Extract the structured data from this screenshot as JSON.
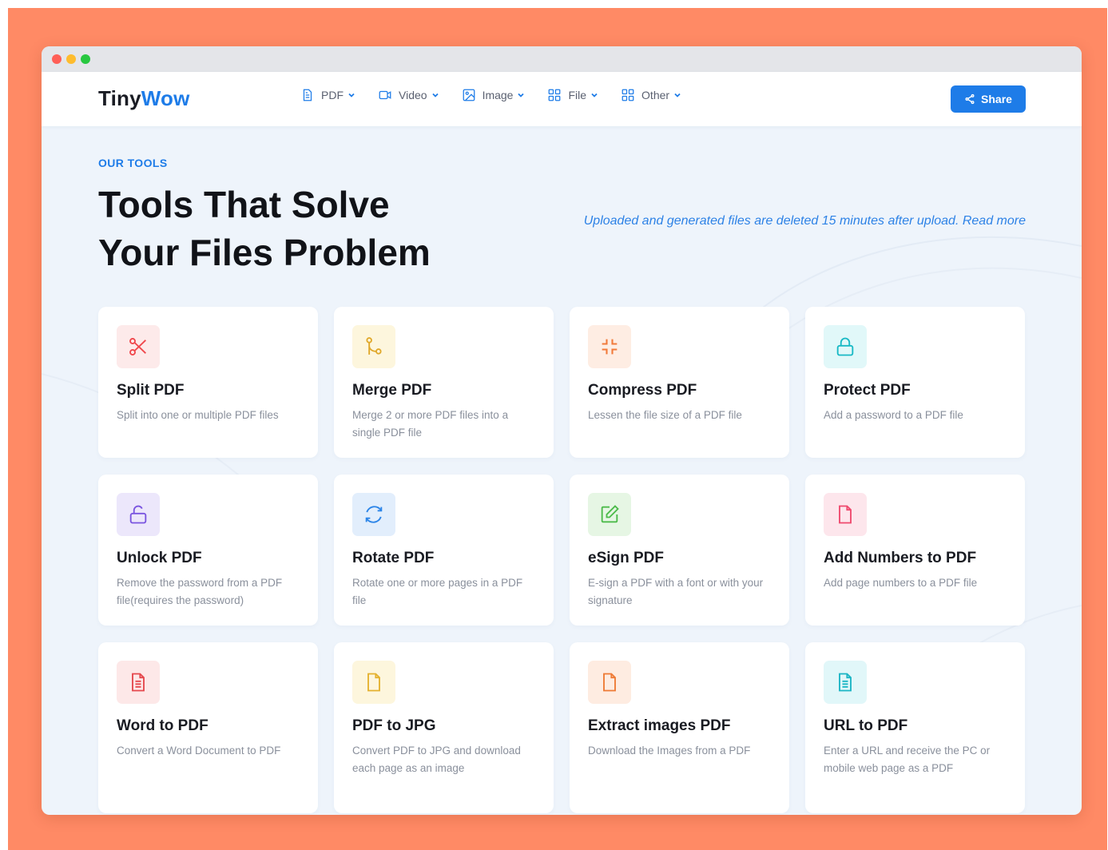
{
  "brand": {
    "name_part1": "Tiny",
    "name_part2": "Wow"
  },
  "nav": {
    "items": [
      {
        "label": "PDF",
        "icon": "document-icon"
      },
      {
        "label": "Video",
        "icon": "video-camera-icon"
      },
      {
        "label": "Image",
        "icon": "image-icon"
      },
      {
        "label": "File",
        "icon": "grid-icon"
      },
      {
        "label": "Other",
        "icon": "grid-icon"
      }
    ],
    "share_label": "Share"
  },
  "hero": {
    "eyebrow": "OUR TOOLS",
    "title_line1": "Tools That Solve",
    "title_line2": "Your Files Problem",
    "notice": "Uploaded and generated files are deleted 15 minutes after upload. Read more"
  },
  "tools": [
    {
      "title": "Split PDF",
      "desc": "Split into one or multiple PDF files",
      "icon": "scissors-icon",
      "color": "#f0464b",
      "bg": "#fdeaea"
    },
    {
      "title": "Merge PDF",
      "desc": "Merge 2 or more PDF files into a single PDF file",
      "icon": "merge-icon",
      "color": "#e0a82a",
      "bg": "#fdf6dd"
    },
    {
      "title": "Compress PDF",
      "desc": "Lessen the file size of a PDF file",
      "icon": "compress-icon",
      "color": "#f17a3a",
      "bg": "#feede3"
    },
    {
      "title": "Protect PDF",
      "desc": "Add a password to a PDF file",
      "icon": "lock-icon",
      "color": "#18b9c5",
      "bg": "#e1f8f9"
    },
    {
      "title": "Unlock PDF",
      "desc": "Remove the password from a PDF file(requires the password)",
      "icon": "unlock-icon",
      "color": "#7a55e0",
      "bg": "#ece7fb"
    },
    {
      "title": "Rotate PDF",
      "desc": "Rotate one or more pages in a PDF file",
      "icon": "rotate-icon",
      "color": "#2c85e8",
      "bg": "#e2eefc"
    },
    {
      "title": "eSign PDF",
      "desc": "E-sign a PDF with a font or with your signature",
      "icon": "edit-icon",
      "color": "#4cbb4a",
      "bg": "#e6f6e4"
    },
    {
      "title": "Add Numbers to PDF",
      "desc": "Add page numbers to a PDF file",
      "icon": "file-icon",
      "color": "#ef4a6e",
      "bg": "#fde6ec"
    },
    {
      "title": "Word to PDF",
      "desc": "Convert a Word Document to PDF",
      "icon": "document-text-icon",
      "color": "#e5484d",
      "bg": "#fde8e8"
    },
    {
      "title": "PDF to JPG",
      "desc": "Convert PDF to JPG and download each page as an image",
      "icon": "file-icon",
      "color": "#e4b12e",
      "bg": "#fdf6dd"
    },
    {
      "title": "Extract images PDF",
      "desc": "Download the Images from a PDF",
      "icon": "file-icon",
      "color": "#ee7a35",
      "bg": "#feece1"
    },
    {
      "title": "URL to PDF",
      "desc": "Enter a URL and receive the PC or mobile web page as a PDF",
      "icon": "document-text-icon",
      "color": "#1bb5c4",
      "bg": "#e1f7f9"
    }
  ]
}
